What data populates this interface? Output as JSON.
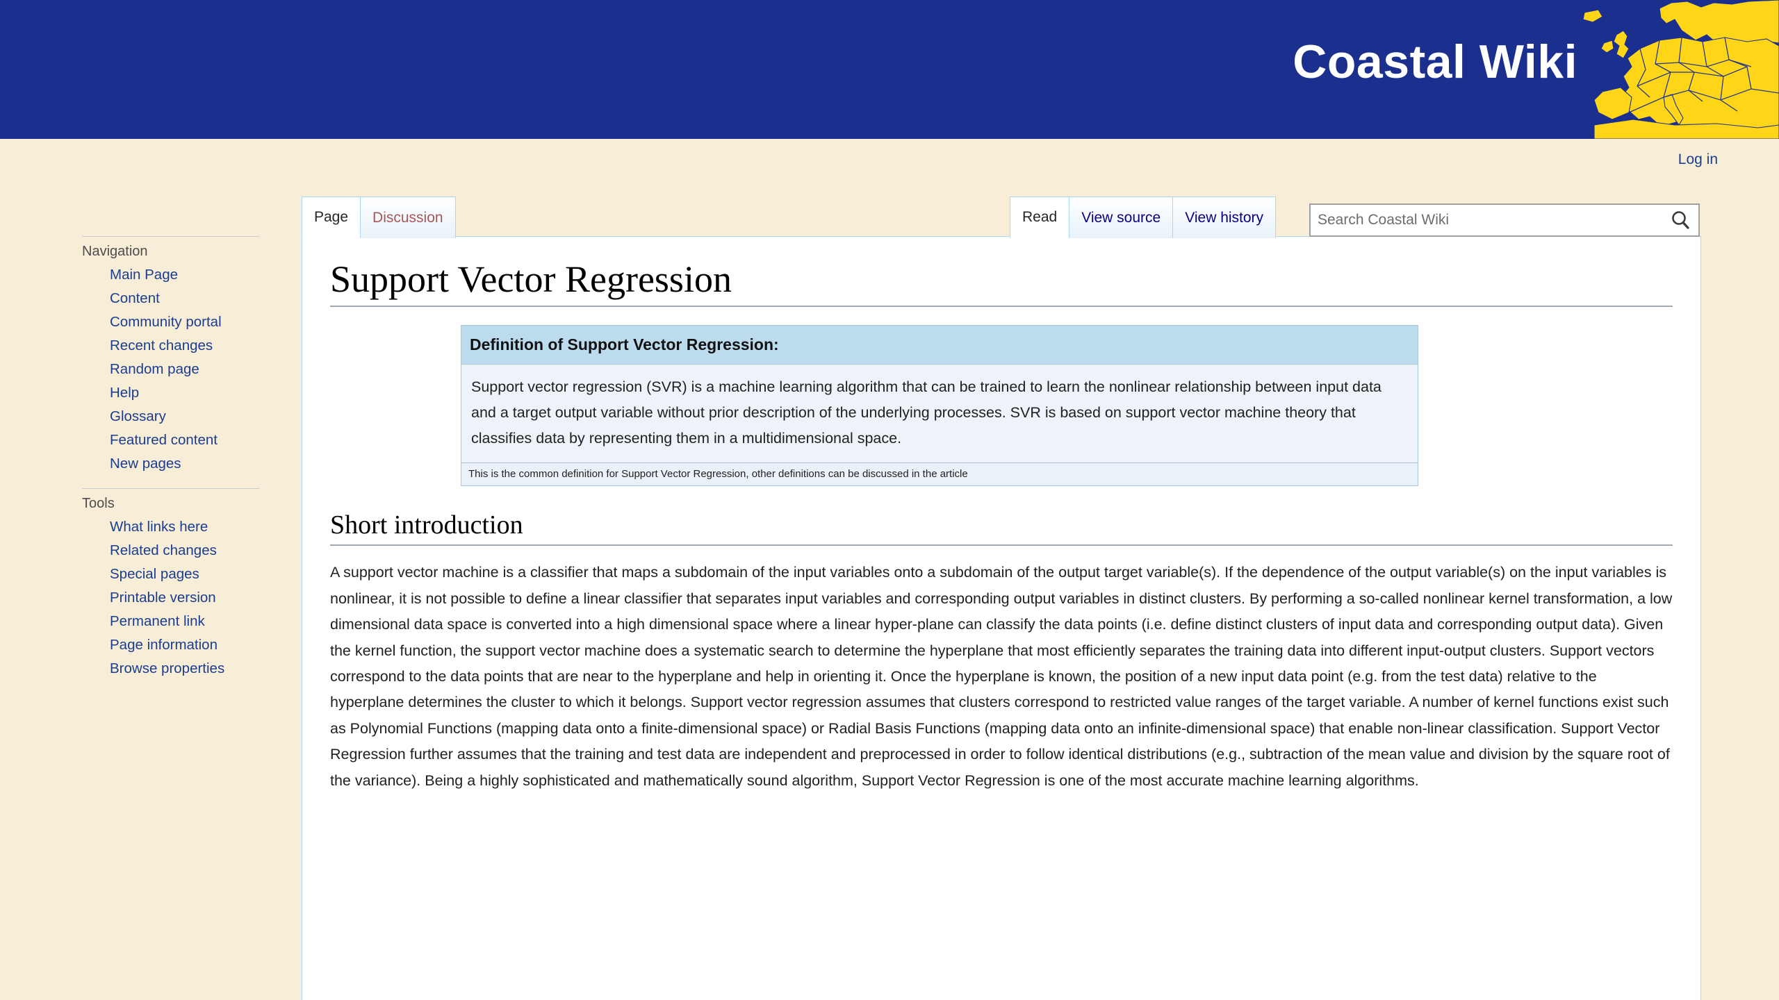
{
  "site": {
    "banner_title": "Coastal Wiki",
    "logo_icon": "europe-map-logo",
    "banner_bg": "#1b2f8e",
    "logo_fill": "#ffd617",
    "page_bg": "#f8eed7"
  },
  "personal": {
    "login_label": "Log in"
  },
  "namespace_tabs": [
    {
      "label": "Page",
      "selected": true,
      "state": "normal"
    },
    {
      "label": "Discussion",
      "selected": false,
      "state": "new"
    }
  ],
  "view_tabs": [
    {
      "label": "Read",
      "selected": true
    },
    {
      "label": "View source",
      "selected": false
    },
    {
      "label": "View history",
      "selected": false
    }
  ],
  "search": {
    "placeholder": "Search Coastal Wiki",
    "value": "",
    "icon": "search-icon"
  },
  "sidebar": {
    "portals": [
      {
        "heading": "Navigation",
        "items": [
          {
            "label": "Main Page"
          },
          {
            "label": "Content"
          },
          {
            "label": "Community portal"
          },
          {
            "label": "Recent changes"
          },
          {
            "label": "Random page"
          },
          {
            "label": "Help"
          },
          {
            "label": "Glossary"
          },
          {
            "label": "Featured content"
          },
          {
            "label": "New pages"
          }
        ]
      },
      {
        "heading": "Tools",
        "items": [
          {
            "label": "What links here"
          },
          {
            "label": "Related changes"
          },
          {
            "label": "Special pages"
          },
          {
            "label": "Printable version"
          },
          {
            "label": "Permanent link"
          },
          {
            "label": "Page information"
          },
          {
            "label": "Browse properties"
          }
        ]
      }
    ]
  },
  "article": {
    "title": "Support Vector Regression",
    "definition": {
      "header": "Definition of Support Vector Regression:",
      "body": "Support vector regression (SVR) is a machine learning algorithm that can be trained to learn the nonlinear relationship between input data and a target output variable without prior description of the underlying processes. SVR is based on support vector machine theory that classifies data by representing them in a multidimensional space.",
      "footer": "This is the common definition for Support Vector Regression, other definitions can be discussed in the article"
    },
    "sections": [
      {
        "heading": "Short introduction",
        "paragraph": "A support vector machine is a classifier that maps a subdomain of the input variables onto a subdomain of the output target variable(s). If the dependence of the output variable(s) on the input variables is nonlinear, it is not possible to define a linear classifier that separates input variables and corresponding output variables in distinct clusters. By performing a so-called nonlinear kernel transformation, a low dimensional data space is converted into a high dimensional space where a linear hyper-plane can classify the data points (i.e. define distinct clusters of input data and corresponding output data). Given the kernel function, the support vector machine does a systematic search to determine the hyperplane that most efficiently separates the training data into different input-output clusters. Support vectors correspond to the data points that are near to the hyperplane and help in orienting it. Once the hyperplane is known, the position of a new input data point (e.g. from the test data) relative to the hyperplane determines the cluster to which it belongs. Support vector regression assumes that clusters correspond to restricted value ranges of the target variable. A number of kernel functions exist such as Polynomial Functions (mapping data onto a finite-dimensional space) or Radial Basis Functions (mapping data onto an infinite-dimensional space) that enable non-linear classification. Support Vector Regression further assumes that the training and test data are independent and preprocessed in order to follow identical distributions (e.g., subtraction of the mean value and division by the square root of the variance). Being a highly sophisticated and mathematically sound algorithm, Support Vector Regression is one of the most accurate machine learning algorithms."
      }
    ]
  }
}
